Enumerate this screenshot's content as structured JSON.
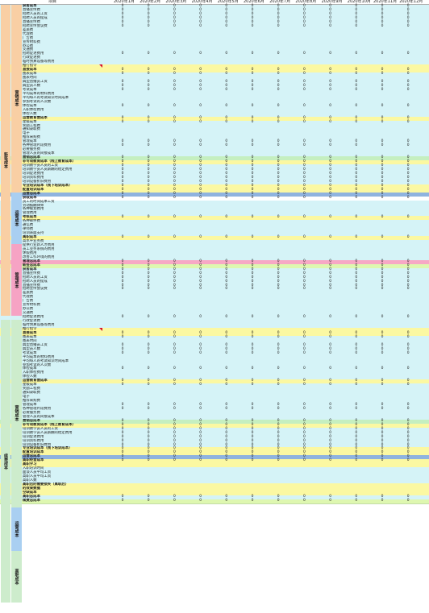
{
  "header": {
    "item_label": "项目",
    "months": [
      "2020年1月",
      "2020年2月",
      "2020年3月",
      "2020年4月",
      "2020年5月",
      "2020年6月",
      "2020年7月",
      "2020年8月",
      "2020年9月",
      "2020年10月",
      "2020年11月",
      "2020年12月"
    ]
  },
  "sections": [
    {
      "title": "新签成本",
      "start": 0,
      "end": 78,
      "color": "#f9cfa4",
      "groups": [
        {
          "title": "营销成本",
          "start": 0,
          "end": 47,
          "color": "#f9cfa4"
        },
        {
          "title": "运营成本",
          "start": 47,
          "end": 60,
          "color": "#a9cff1"
        },
        {
          "title": "管理成本",
          "start": 60,
          "end": 78,
          "color": "#f6a3c4"
        }
      ]
    },
    {
      "title": "续费成本",
      "start": 79,
      "end": 150,
      "color": "#cdeccc",
      "groups": [
        {
          "title": "营销成本",
          "start": 79,
          "end": 126,
          "color": "#cdeccc"
        },
        {
          "title": "运营成本",
          "start": 126,
          "end": 137,
          "color": "#a9cff1"
        },
        {
          "title": "高职成本",
          "start": 137,
          "end": 150,
          "color": "#cdeccc"
        }
      ]
    }
  ],
  "rows": [
    {
      "label": "获客成本",
      "style": "cyan",
      "strong": true,
      "zeros": true
    },
    {
      "label": "直播宣传费",
      "style": "cyan",
      "zeros": true
    },
    {
      "label": "招聘人员的工资",
      "style": "cyan",
      "zeros": true
    },
    {
      "label": "招聘人员的提成",
      "style": "cyan",
      "zeros": true
    },
    {
      "label": "直播宣传费",
      "style": "cyan",
      "zeros": true
    },
    {
      "label": "招聘宣传会议费",
      "style": "cyan",
      "zeros": true
    },
    {
      "label": "差旅费",
      "style": "cyan",
      "zeros": false
    },
    {
      "label": "代理费",
      "style": "cyan",
      "zeros": false
    },
    {
      "label": "广告费",
      "style": "cyan",
      "zeros": false
    },
    {
      "label": "宣传材料费",
      "style": "cyan",
      "zeros": false
    },
    {
      "label": "办公费",
      "style": "cyan",
      "zeros": false
    },
    {
      "label": "交通费",
      "style": "cyan",
      "zeros": false
    },
    {
      "label": "招聘促进费用",
      "style": "cyan",
      "zeros": true
    },
    {
      "label": "行政促进费",
      "style": "cyan",
      "zeros": false
    },
    {
      "label": "临时预算设备等费用",
      "style": "cyan",
      "zeros": false
    },
    {
      "label": "推行指令",
      "style": "yellow",
      "zeros": false,
      "flag": true
    },
    {
      "label": "直接成本",
      "style": "yellow",
      "strong": true,
      "zeros": true
    },
    {
      "label": "图表成本",
      "style": "cyan",
      "zeros": true
    },
    {
      "label": "图表时间",
      "style": "cyan",
      "zeros": false
    },
    {
      "label": "典型直播员工资",
      "style": "cyan",
      "zeros": true
    },
    {
      "label": "典型员人数",
      "style": "cyan",
      "zeros": true
    },
    {
      "label": "考试成本",
      "style": "cyan",
      "zeros": true
    },
    {
      "label": "平均成本的材料费用",
      "style": "cyan",
      "zeros": false
    },
    {
      "label": "平均每人的考试知识时间成本",
      "style": "cyan",
      "zeros": false
    },
    {
      "label": "参加考试的人次数",
      "style": "cyan",
      "zeros": false
    },
    {
      "label": "体检成本",
      "style": "cyan",
      "zeros": true
    },
    {
      "label": "入职体检费用",
      "style": "cyan",
      "zeros": false
    },
    {
      "label": "体检人数",
      "style": "cyan",
      "zeros": false
    },
    {
      "label": "运营教育营成本",
      "style": "yellow",
      "strong": true,
      "zeros": true
    },
    {
      "label": "星级成本",
      "style": "cyan",
      "zeros": true
    },
    {
      "label": "奖励工程费",
      "style": "cyan",
      "zeros": false
    },
    {
      "label": "通知录取费",
      "style": "cyan",
      "zeros": false
    },
    {
      "label": "电子",
      "style": "cyan",
      "zeros": false
    },
    {
      "label": "推荐采购费",
      "style": "cyan",
      "zeros": false
    },
    {
      "label": "管理成本",
      "style": "cyan",
      "zeros": true
    },
    {
      "label": "各种管理片段费用",
      "style": "cyan",
      "zeros": true
    },
    {
      "label": "必要服务费",
      "style": "cyan",
      "zeros": false
    },
    {
      "label": "管理人员的间接成本",
      "style": "cyan",
      "zeros": false
    },
    {
      "label": "营销总成本",
      "style": "green",
      "strong": true,
      "zeros": true
    },
    {
      "label": "非专项教育成本（线上教育成本）",
      "style": "yellow",
      "strong": true,
      "zeros": true
    },
    {
      "label": "培训教学员人员的工资",
      "style": "cyan",
      "zeros": true
    },
    {
      "label": "培训教学员人员薪酬的稳定费用",
      "style": "cyan",
      "zeros": true
    },
    {
      "label": "培训促进费用",
      "style": "cyan",
      "zeros": true
    },
    {
      "label": "培训资料费用",
      "style": "cyan",
      "zeros": true
    },
    {
      "label": "培训设备折旧费用",
      "style": "cyan",
      "zeros": true
    },
    {
      "label": "专业培训成本（线下培训成本）",
      "style": "yellow",
      "strong": true,
      "zeros": true
    },
    {
      "label": "配置培训成本",
      "style": "yellow",
      "strong": true,
      "zeros": true
    },
    {
      "label": "运营总成本",
      "style": "blue",
      "strong": true,
      "zeros": true
    },
    {
      "label": "获取成本",
      "style": "white",
      "strong": true,
      "zeros": true
    },
    {
      "label": "员工的时间成本工资",
      "style": "cyan",
      "zeros": false
    },
    {
      "label": "劳动报酬律师",
      "style": "cyan",
      "zeros": false
    },
    {
      "label": "各种规划费用",
      "style": "cyan",
      "zeros": false
    },
    {
      "label": "管理费用",
      "style": "cyan",
      "zeros": false
    },
    {
      "label": "考核成本",
      "style": "yellow",
      "strong": true,
      "zeros": true
    },
    {
      "label": "各种邮件费",
      "style": "cyan",
      "zeros": false
    },
    {
      "label": "通信费",
      "style": "cyan",
      "zeros": false
    },
    {
      "label": "律师费",
      "style": "cyan",
      "zeros": false
    },
    {
      "label": "培训表面支持",
      "style": "cyan",
      "zeros": false
    },
    {
      "label": "离职成本",
      "style": "yellow",
      "strong": true,
      "zeros": true
    },
    {
      "label": "高水平业务费",
      "style": "cyan",
      "zeros": false
    },
    {
      "label": "提供行业新人才费用",
      "style": "cyan",
      "zeros": false
    },
    {
      "label": "员工业务系统的费用",
      "style": "cyan",
      "zeros": false
    },
    {
      "label": "休假费用",
      "style": "cyan",
      "zeros": false
    },
    {
      "label": "改善工作环境的费用",
      "style": "cyan",
      "zeros": false
    },
    {
      "label": "管理总成本",
      "style": "pink",
      "strong": true,
      "zeros": true
    },
    {
      "label": "新签总成本",
      "style": "lime",
      "strong": true,
      "zeros": true
    },
    {
      "label": "获客成本",
      "style": "cyan",
      "strong": true,
      "zeros": true
    },
    {
      "label": "直播宣传费",
      "style": "cyan",
      "zeros": true
    },
    {
      "label": "招聘人员的工资",
      "style": "cyan",
      "zeros": true
    },
    {
      "label": "招聘人员的提成",
      "style": "cyan",
      "zeros": true
    },
    {
      "label": "直播宣传费",
      "style": "cyan",
      "zeros": true
    },
    {
      "label": "招聘宣传会议费",
      "style": "cyan",
      "zeros": true
    },
    {
      "label": "差旅费",
      "style": "cyan",
      "zeros": false
    },
    {
      "label": "代理费",
      "style": "cyan",
      "zeros": false
    },
    {
      "label": "广告费",
      "style": "cyan",
      "zeros": false
    },
    {
      "label": "宣传材料费",
      "style": "cyan",
      "zeros": false
    },
    {
      "label": "办公费",
      "style": "cyan",
      "zeros": false
    },
    {
      "label": "交通费",
      "style": "cyan",
      "zeros": false
    },
    {
      "label": "招聘促进费用",
      "style": "cyan",
      "zeros": true
    },
    {
      "label": "行政促进费",
      "style": "cyan",
      "zeros": false
    },
    {
      "label": "临时预算设备等费用",
      "style": "cyan",
      "zeros": false
    },
    {
      "label": "推行指令",
      "style": "yellow",
      "zeros": false,
      "flag": true
    },
    {
      "label": "直接成本",
      "style": "yellow",
      "strong": true,
      "zeros": true
    },
    {
      "label": "图表成本",
      "style": "cyan",
      "zeros": true
    },
    {
      "label": "图表时间",
      "style": "cyan",
      "zeros": false
    },
    {
      "label": "典型直播员工资",
      "style": "cyan",
      "zeros": true
    },
    {
      "label": "典型员人数",
      "style": "cyan",
      "zeros": true
    },
    {
      "label": "考试成本",
      "style": "cyan",
      "zeros": true
    },
    {
      "label": "平均成本的材料费用",
      "style": "cyan",
      "zeros": false
    },
    {
      "label": "平均每人的考试知识时间成本",
      "style": "cyan",
      "zeros": false
    },
    {
      "label": "参加考试的人次数",
      "style": "cyan",
      "zeros": false
    },
    {
      "label": "体检成本",
      "style": "cyan",
      "zeros": true
    },
    {
      "label": "入职体检费用",
      "style": "cyan",
      "zeros": false
    },
    {
      "label": "体检人数",
      "style": "cyan",
      "zeros": false
    },
    {
      "label": "运营教育营成本",
      "style": "yellow",
      "strong": true,
      "zeros": true
    },
    {
      "label": "星级成本",
      "style": "cyan",
      "zeros": true
    },
    {
      "label": "奖励工程费",
      "style": "cyan",
      "zeros": false
    },
    {
      "label": "通知录取费",
      "style": "cyan",
      "zeros": false
    },
    {
      "label": "电子",
      "style": "cyan",
      "zeros": false
    },
    {
      "label": "推荐采购费",
      "style": "cyan",
      "zeros": false
    },
    {
      "label": "管理成本",
      "style": "cyan",
      "zeros": true
    },
    {
      "label": "各种管理片段费用",
      "style": "cyan",
      "zeros": true
    },
    {
      "label": "必要服务费",
      "style": "cyan",
      "zeros": false
    },
    {
      "label": "管理人员的间接成本",
      "style": "cyan",
      "zeros": false
    },
    {
      "label": "营销总成本",
      "style": "green",
      "strong": true,
      "zeros": true
    },
    {
      "label": "非专项教育成本（线上教育成本）",
      "style": "yellow",
      "strong": true,
      "zeros": true
    },
    {
      "label": "培训教学员人员的工资",
      "style": "cyan",
      "zeros": true
    },
    {
      "label": "培训教学员人员薪酬的稳定费用",
      "style": "cyan",
      "zeros": true
    },
    {
      "label": "培训促进费用",
      "style": "cyan",
      "zeros": true
    },
    {
      "label": "培训资料费用",
      "style": "cyan",
      "zeros": true
    },
    {
      "label": "培训设备折旧费用",
      "style": "cyan",
      "zeros": true
    },
    {
      "label": "专业培训成本（线下培训成本）",
      "style": "yellow",
      "strong": true,
      "zeros": true
    },
    {
      "label": "配置培训成本",
      "style": "yellow",
      "strong": true,
      "zeros": true
    },
    {
      "label": "运营总成本",
      "style": "blue",
      "strong": true,
      "zeros": true
    },
    {
      "label": "高职经营成本",
      "style": "yellow",
      "strong": true,
      "zeros": true
    },
    {
      "label": "高职学习",
      "style": "yellow",
      "strong": true,
      "zeros": false
    },
    {
      "label": "入职培训时间",
      "style": "cyan",
      "zeros": false
    },
    {
      "label": "面谈人员平均工资",
      "style": "cyan",
      "zeros": false
    },
    {
      "label": "高职人员平均工资",
      "style": "cyan",
      "zeros": false
    },
    {
      "label": "高职人数",
      "style": "cyan",
      "zeros": false
    },
    {
      "label": "高职后的需要损失（离职后）",
      "style": "yellow",
      "strong": true,
      "zeros": false
    },
    {
      "label": "的效果数据",
      "style": "yellow",
      "strong": true,
      "zeros": false
    },
    {
      "label": "空缺成本",
      "style": "yellow",
      "strong": true,
      "zeros": false
    },
    {
      "label": "高职总成本",
      "style": "cyan",
      "strong": true,
      "zeros": true
    },
    {
      "label": "续费总成本",
      "style": "lime",
      "strong": true,
      "zeros": true
    }
  ],
  "cell_value": "0"
}
